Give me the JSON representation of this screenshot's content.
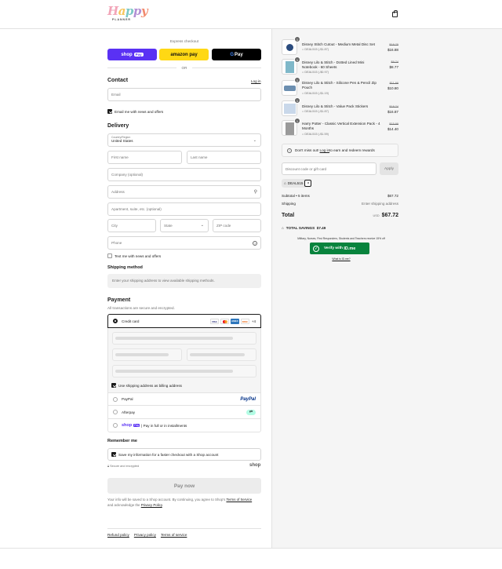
{
  "brand": {
    "logo_letters": [
      "H",
      "a",
      "p",
      "p",
      "y"
    ],
    "logo_sub": "PLANNER"
  },
  "express": {
    "label": "Express checkout",
    "shop_pay": "shop",
    "shop_pay_badge": "Pay",
    "amazon_pay": "amazon pay",
    "gpay_g": "G",
    "gpay_text": "Pay",
    "or": "OR"
  },
  "contact": {
    "heading": "Contact",
    "login": "Log in",
    "email_placeholder": "Email",
    "news_label": "Email me with news and offers"
  },
  "delivery": {
    "heading": "Delivery",
    "country_label": "Country/Region",
    "country_value": "United States",
    "first_name": "First name",
    "last_name": "Last name",
    "company": "Company (optional)",
    "address": "Address",
    "apartment": "Apartment, suite, etc. (optional)",
    "city": "City",
    "state": "State",
    "zip": "ZIP code",
    "phone": "Phone",
    "text_me": "Text me with news and offers"
  },
  "shipping": {
    "heading": "Shipping method",
    "note": "Enter your shipping address to view available shipping methods."
  },
  "payment": {
    "heading": "Payment",
    "subtitle": "All transactions are secure and encrypted.",
    "credit_card": "Credit card",
    "cards": [
      "VISA",
      "MC",
      "AMEX",
      "DISC"
    ],
    "more_cards": "+4",
    "billing_same": "Use shipping address as billing address",
    "paypal": "PayPal",
    "paypal_logo": "PayPal",
    "afterpay": "Afterpay",
    "shoppay_logo": "shop",
    "shoppay_badge": "Pay",
    "shoppay_text": "| Pay in full or in installments"
  },
  "remember": {
    "heading": "Remember me",
    "label": "Save my information for a faster checkout with a Shop account",
    "secure": "Secure and encrypted",
    "shop_logo": "shop"
  },
  "pay_now": "Pay now",
  "legal": {
    "text1": "Your info will be saved to a Shop account. By continuing, you agree to Shop's ",
    "tos": "Terms of Service",
    "text2": "and acknowledge the ",
    "privacy": "Privacy Policy",
    "text3": "."
  },
  "footer": {
    "refund": "Refund policy",
    "privacy": "Privacy policy",
    "terms": "Terms of service"
  },
  "cart": {
    "items": [
      {
        "qty": "1",
        "title": "Disney Stitch Cutout - Medium Metal Disc Set",
        "code": "DEAL515 (-$1.87)",
        "old": "$18.75",
        "new": "$16.88"
      },
      {
        "qty": "1",
        "title": "Disney Lilo & Stitch - Dotted Lined Mini Notebook - 60 Sheets",
        "code": "DEAL515 (-$0.97)",
        "old": "$9.74",
        "new": "$8.77"
      },
      {
        "qty": "1",
        "title": "Disney Lilo & Stitch - Silicone Pen & Pencil Zip Pouch",
        "code": "DEAL515 (-$1.19)",
        "old": "$11.99",
        "new": "$10.80"
      },
      {
        "qty": "1",
        "title": "Disney Lilo & Stitch - Value Pack Stickers",
        "code": "DEAL515 (-$1.87)",
        "old": "$18.74",
        "new": "$16.87"
      },
      {
        "qty": "1",
        "title": "Harry Potter - Classic Vertical Extension Pack - 4 Months",
        "code": "DEAL515 (-$1.59)",
        "old": "$15.99",
        "new": "$14.40"
      }
    ],
    "rewards_text": "Don't miss out! ",
    "rewards_link": "Log in",
    "rewards_text2": " to earn and redeem rewards",
    "discount_placeholder": "Discount code or gift card",
    "apply": "Apply",
    "tag": "DEAL515",
    "subtotal_label": "Subtotal • 5 items",
    "subtotal_value": "$67.72",
    "shipping_label": "Shipping",
    "shipping_value": "Enter shipping address",
    "total_label": "Total",
    "currency": "USD",
    "total_value": "$67.72",
    "savings_label": "TOTAL SAVINGS",
    "savings_value": "$7.49",
    "idme_note": "Military, Nurses, First Responders, Students and Teachers receive 15% off",
    "idme_btn": "Verify with",
    "idme_logo": "ID.me",
    "idme_link": "What is ID.me?"
  }
}
